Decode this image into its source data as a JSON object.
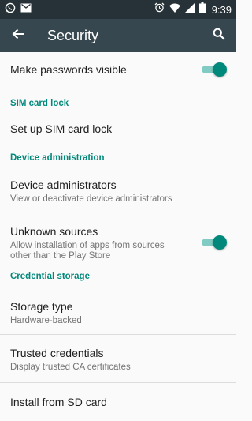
{
  "status_bar": {
    "time": "9:39",
    "icons": [
      "whatsapp-icon",
      "gmail-icon",
      "alarm-icon",
      "wifi-icon",
      "signal-icon",
      "battery-icon"
    ]
  },
  "toolbar": {
    "title": "Security",
    "back_icon": "arrow-back-icon",
    "search_icon": "search-icon",
    "background": "#37474f"
  },
  "accent_color": "#00897b",
  "settings": {
    "make_passwords_visible": {
      "title": "Make passwords visible",
      "enabled": true
    },
    "sim_card_lock_header": "SIM card lock",
    "set_up_sim_card_lock": {
      "title": "Set up SIM card lock"
    },
    "device_administration_header": "Device administration",
    "device_administrators": {
      "title": "Device administrators",
      "summary": "View or deactivate device administrators"
    },
    "unknown_sources": {
      "title": "Unknown sources",
      "summary_line1": "Allow installation of apps from sources",
      "summary_line2": "other than the Play Store",
      "enabled": true
    },
    "credential_storage_header": "Credential storage",
    "storage_type": {
      "title": "Storage type",
      "summary": "Hardware-backed"
    },
    "trusted_credentials": {
      "title": "Trusted credentials",
      "summary": "Display trusted CA certificates"
    },
    "install_from_sd_card": {
      "title": "Install from SD card"
    }
  }
}
